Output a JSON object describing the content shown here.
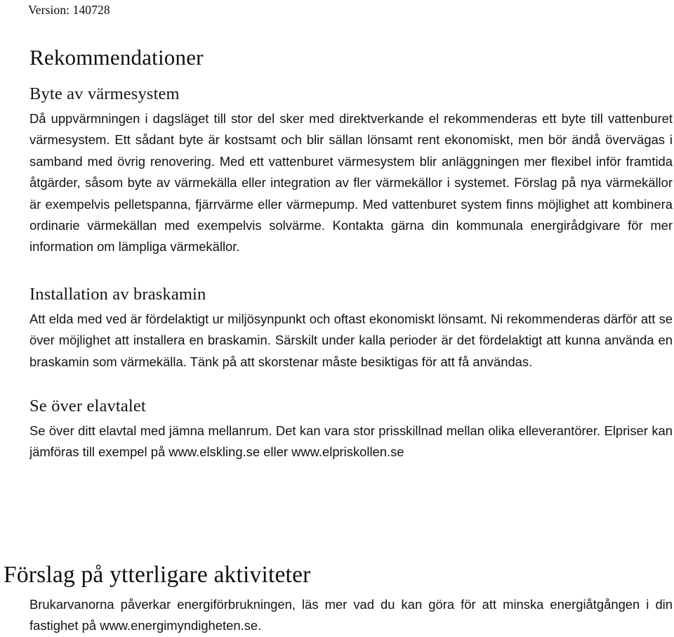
{
  "document": {
    "version_label": "Version: 140728",
    "title": "Rekommendationer"
  },
  "sections": [
    {
      "heading": "Byte av värmesystem",
      "body": "Då uppvärmningen i dagsläget till stor del sker med direktverkande el rekommenderas ett byte till vattenburet värmesystem. Ett sådant byte är kostsamt och blir sällan lönsamt rent ekonomiskt, men bör ändå övervägas i samband med övrig renovering. Med ett vattenburet värmesystem blir anläggningen mer flexibel inför framtida åtgärder, såsom byte av värmekälla eller integration av fler värmekällor i systemet. Förslag på nya värmekällor är exempelvis pelletspanna, fjärrvärme eller värmepump. Med vattenburet system finns möjlighet att kombinera ordinarie värmekällan med exempelvis solvärme. Kontakta gärna din kommunala energirådgivare för mer information om lämpliga värmekällor."
    },
    {
      "heading": "Installation av braskamin",
      "body": "Att elda med ved är fördelaktigt ur miljösynpunkt och oftast ekonomiskt lönsamt. Ni rekommenderas därför att se över möjlighet att installera en braskamin. Särskilt under kalla perioder är det fördelaktigt att kunna använda en braskamin som värmekälla. Tänk på att skorstenar måste besiktigas för att få användas."
    },
    {
      "heading": "Se över elavtalet",
      "body": "Se över ditt elavtal med jämna mellanrum. Det kan vara stor prisskillnad mellan olika elleverantörer. Elpriser kan jämföras till exempel på www.elskling.se eller www.elpriskollen.se"
    }
  ],
  "footer_section": {
    "heading": "Förslag på ytterligare aktiviteter",
    "body": "Brukarvanorna påverkar energiförbrukningen, läs mer vad du kan göra för att minska energiåtgången i din fastighet på www.energimyndigheten.se."
  }
}
